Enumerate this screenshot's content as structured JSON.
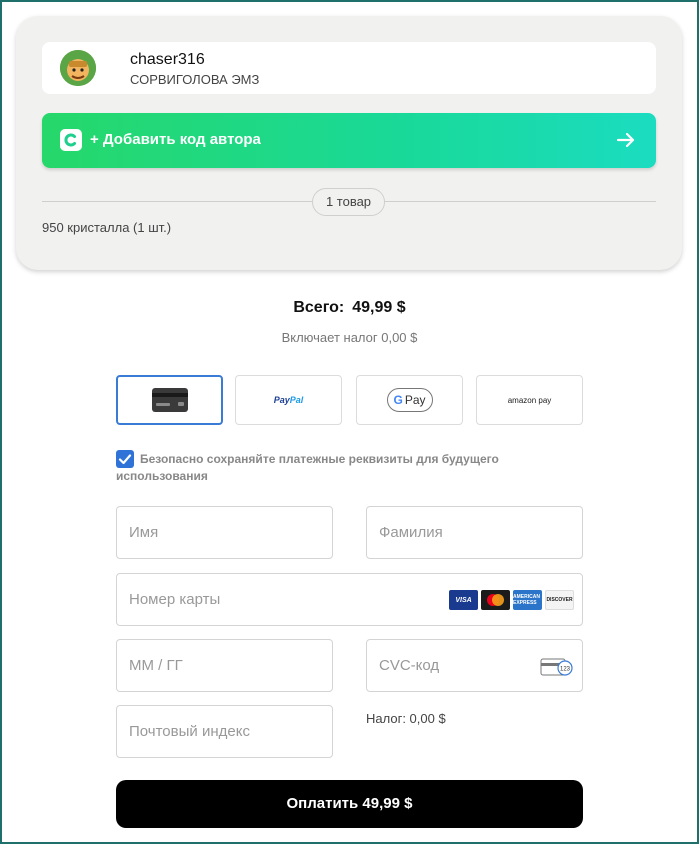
{
  "profile": {
    "username": "chaser316",
    "clan": "СОРВИГОЛОВА ЭМЗ"
  },
  "creator": {
    "label": "+ Добавить код автора",
    "logo_icon": "creator-code-logo-icon",
    "arrow_icon": "arrow-right-icon"
  },
  "cart": {
    "items_badge": "1 товар",
    "item_line": "950 кристалла (1 шт.)"
  },
  "summary": {
    "total_label": "Всего:",
    "total_value": "49,99 $",
    "tax_note": "Включает налог 0,00 $"
  },
  "payment_methods": {
    "card_icon": "credit-card-icon",
    "paypal_a": "Pay",
    "paypal_b": "Pal",
    "gpay_g": "G",
    "gpay_text": "Pay",
    "amazon": "amazon pay",
    "selected": "card"
  },
  "save_details": {
    "checked": true,
    "label": "Безопасно сохраняйте платежные реквизиты для будущего использования"
  },
  "form": {
    "first_name_placeholder": "Имя",
    "last_name_placeholder": "Фамилия",
    "card_number_placeholder": "Номер карты",
    "expiry_placeholder": "ММ / ГГ",
    "cvc_placeholder": "CVC-код",
    "zip_placeholder": "Почтовый индекс",
    "brands": [
      "VISA",
      "AMERICAN EXPRESS",
      "DISCOVER"
    ],
    "tax": "Налог: 0,00 $"
  },
  "pay_button": {
    "label": "Оплатить 49,99 $"
  },
  "colors": {
    "accent_green": "#19d99a",
    "selected_border": "#3a7bd5",
    "pay_button": "#000000"
  }
}
